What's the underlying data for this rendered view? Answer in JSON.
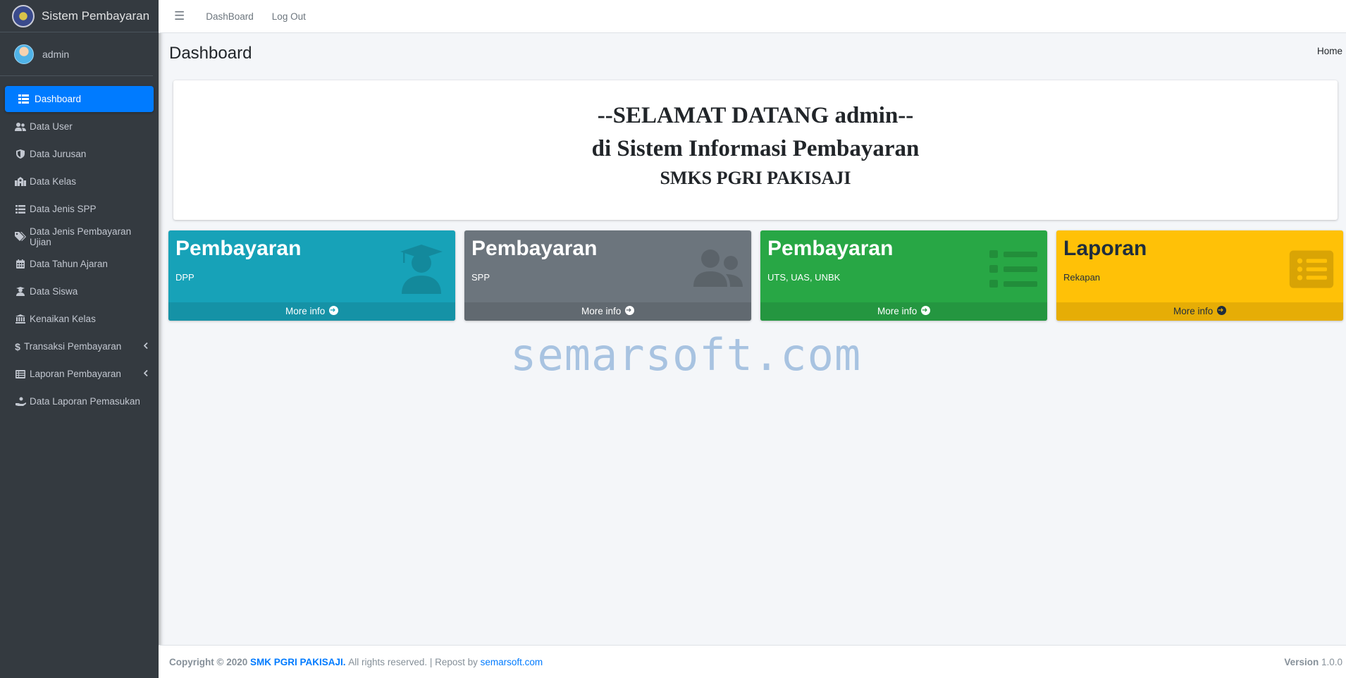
{
  "brand": {
    "title": "Sistem Pembayaran"
  },
  "user": {
    "name": "admin"
  },
  "sidebar": {
    "items": [
      {
        "label": "Dashboard",
        "icon": "grid-icon",
        "active": true
      },
      {
        "label": "Data User",
        "icon": "users-icon"
      },
      {
        "label": "Data Jurusan",
        "icon": "shield-icon"
      },
      {
        "label": "Data Kelas",
        "icon": "school-icon"
      },
      {
        "label": "Data Jenis SPP",
        "icon": "list-icon"
      },
      {
        "label": "Data Jenis Pembayaran Ujian",
        "icon": "tags-icon"
      },
      {
        "label": "Data Tahun Ajaran",
        "icon": "calendar-icon"
      },
      {
        "label": "Data Siswa",
        "icon": "user-graduate-icon"
      },
      {
        "label": "Kenaikan Kelas",
        "icon": "bank-icon"
      },
      {
        "label": "Transaksi Pembayaran",
        "icon": "dollar-icon",
        "has_children": true
      },
      {
        "label": "Laporan Pembayaran",
        "icon": "table-list-icon",
        "has_children": true
      },
      {
        "label": "Data Laporan Pemasukan",
        "icon": "hand-coin-icon"
      }
    ]
  },
  "topbar": {
    "link1": "DashBoard",
    "link2": "Log Out"
  },
  "page": {
    "title": "Dashboard",
    "breadcrumb": "Home"
  },
  "welcome": {
    "line1": "--SELAMAT DATANG admin--",
    "line2": "di Sistem Informasi Pembayaran",
    "line3": "SMKS PGRI PAKISAJI"
  },
  "boxes": [
    {
      "title": "Pembayaran",
      "subtitle": "DPP",
      "footer": "More info",
      "color": "#17a2b8",
      "icon": "user-graduate-icon"
    },
    {
      "title": "Pembayaran",
      "subtitle": "SPP",
      "footer": "More info",
      "color": "#6c757d",
      "icon": "users-icon"
    },
    {
      "title": "Pembayaran",
      "subtitle": "UTS, UAS, UNBK",
      "footer": "More info",
      "color": "#28a745",
      "icon": "list-icon"
    },
    {
      "title": "Laporan",
      "subtitle": "Rekapan",
      "footer": "More info",
      "color": "#ffc107",
      "icon": "rectangle-list-icon"
    }
  ],
  "watermark": "semarsoft.com",
  "footer": {
    "copyright_prefix": "Copyright © 2020",
    "org": "SMK PGRI PAKISAJI.",
    "rights": "All rights reserved. | Repost by",
    "repost_link": "semarsoft.com",
    "version_label": "Version",
    "version": "1.0.0"
  },
  "colors": {
    "sidebar_bg": "#343a40",
    "active": "#007bff",
    "content_bg": "#f4f6f9"
  }
}
